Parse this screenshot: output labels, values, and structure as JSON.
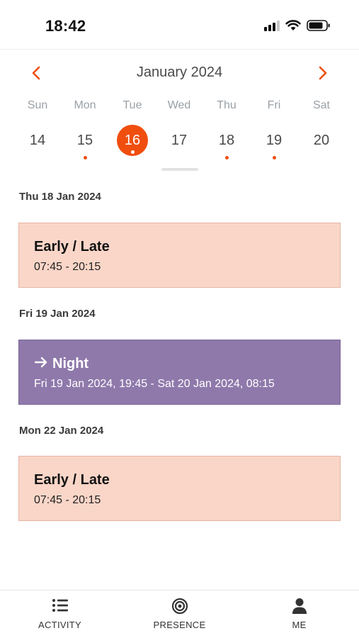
{
  "status_bar": {
    "time": "18:42"
  },
  "calendar": {
    "month_label": "January 2024",
    "weekdays": [
      "Sun",
      "Mon",
      "Tue",
      "Wed",
      "Thu",
      "Fri",
      "Sat"
    ],
    "days": [
      "14",
      "15",
      "16",
      "17",
      "18",
      "19",
      "20"
    ],
    "selected_day": "16",
    "days_with_events": [
      "15",
      "16",
      "18",
      "19"
    ]
  },
  "shifts": [
    {
      "date": "Thu 18 Jan 2024",
      "title": "Early / Late",
      "time": "07:45 - 20:15",
      "color": "#fad6c8"
    },
    {
      "date": "Fri 19 Jan 2024",
      "title": "Night",
      "time": "Fri 19 Jan 2024, 19:45 - Sat 20 Jan 2024, 08:15",
      "color": "#8f79ab",
      "icon": "arrow-right-icon"
    },
    {
      "date": "Mon 22 Jan 2024",
      "title": "Early / Late",
      "time": "07:45 - 20:15",
      "color": "#fad6c8"
    }
  ],
  "bottom_nav": [
    {
      "label": "ACTIVITY",
      "icon": "list-icon"
    },
    {
      "label": "PRESENCE",
      "icon": "target-icon"
    },
    {
      "label": "ME",
      "icon": "person-icon"
    }
  ],
  "colors": {
    "accent": "#f04e0f",
    "early_shift": "#fad6c8",
    "night_shift": "#8f79ab"
  }
}
